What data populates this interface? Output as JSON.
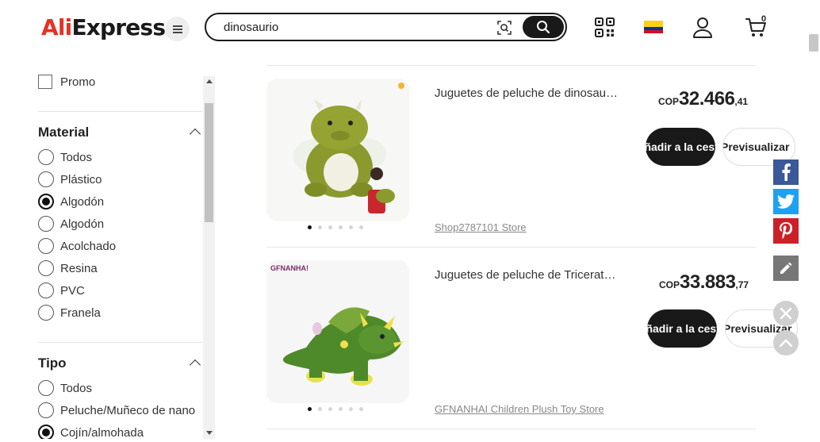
{
  "header": {
    "logo_ali": "Ali",
    "logo_express": "Express",
    "search_value": "dinosaurio",
    "cart_count": "0",
    "flag_colors": [
      "#fcd116",
      "#003893",
      "#ce1126"
    ]
  },
  "filters": {
    "promo_label": "Promo",
    "material": {
      "title": "Material",
      "options": [
        "Todos",
        "Plástico",
        "Algodón",
        "Algodón",
        "Acolchado",
        "Resina",
        "PVC",
        "Franela"
      ],
      "selected_index": 2
    },
    "tipo": {
      "title": "Tipo",
      "options": [
        "Todos",
        "Peluche/Muñeco de nano",
        "Cojín/almohada"
      ],
      "selected_index": 2
    }
  },
  "products": [
    {
      "title": "Juguetes de peluche de dinosaurio de dibujos animados",
      "store": "Shop2787101 Store",
      "price_currency": "COP",
      "price_int": "32.466",
      "price_dec": ",41",
      "add_label": "Añadir a la cesta",
      "preview_label": "Previsualizar",
      "image_count": 6
    },
    {
      "title": "Juguetes de peluche de Triceratops de dinosaurio",
      "store": "GFNANHAI Children Plush Toy Store",
      "price_currency": "COP",
      "price_int": "33.883",
      "price_dec": ",77",
      "add_label": "Añadir a la cesta",
      "preview_label": "Previsualizar",
      "image_count": 6,
      "brand_label": "GFNANHA!"
    }
  ],
  "share": {
    "colors": {
      "facebook": "#3b5998",
      "twitter": "#1da1f2",
      "pinterest": "#cb2027"
    }
  }
}
